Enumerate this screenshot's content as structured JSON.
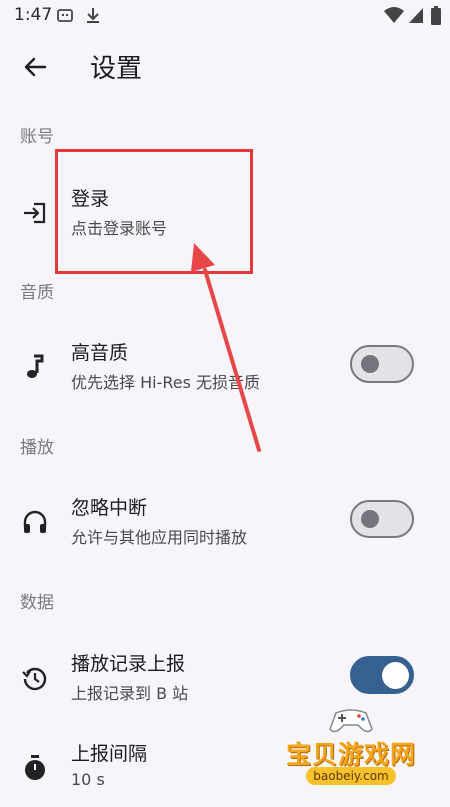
{
  "status_bar": {
    "time": "1:47",
    "left_icons": [
      "sim-icon",
      "download-icon"
    ],
    "right_icons": [
      "wifi-icon",
      "signal-icon",
      "battery-icon"
    ]
  },
  "app_bar": {
    "title": "设置",
    "back_icon": "arrow-back-icon"
  },
  "sections": {
    "account": {
      "header": "账号",
      "login": {
        "title": "登录",
        "subtitle": "点击登录账号",
        "icon": "login-icon"
      }
    },
    "audio": {
      "header": "音质",
      "hires": {
        "title": "高音质",
        "subtitle": "优先选择 Hi-Res 无损音质",
        "icon": "music-note-icon",
        "enabled": false
      }
    },
    "playback": {
      "header": "播放",
      "ignore_interrupt": {
        "title": "忽略中断",
        "subtitle": "允许与其他应用同时播放",
        "icon": "headphones-icon",
        "enabled": false
      }
    },
    "data": {
      "header": "数据",
      "report_history": {
        "title": "播放记录上报",
        "subtitle": "上报记录到 B 站",
        "icon": "history-icon",
        "enabled": true
      },
      "report_interval": {
        "title": "上报间隔",
        "subtitle": "10 s",
        "icon": "timer-icon"
      }
    }
  },
  "annotation": {
    "highlight_color": "#e23a3a"
  },
  "watermark": {
    "title": "宝贝游戏网",
    "url": "baobeiy.com"
  },
  "colors": {
    "background": "#f7f5fa",
    "toggle_on": "#35608f",
    "toggle_off_track": "#e4e2e8"
  }
}
